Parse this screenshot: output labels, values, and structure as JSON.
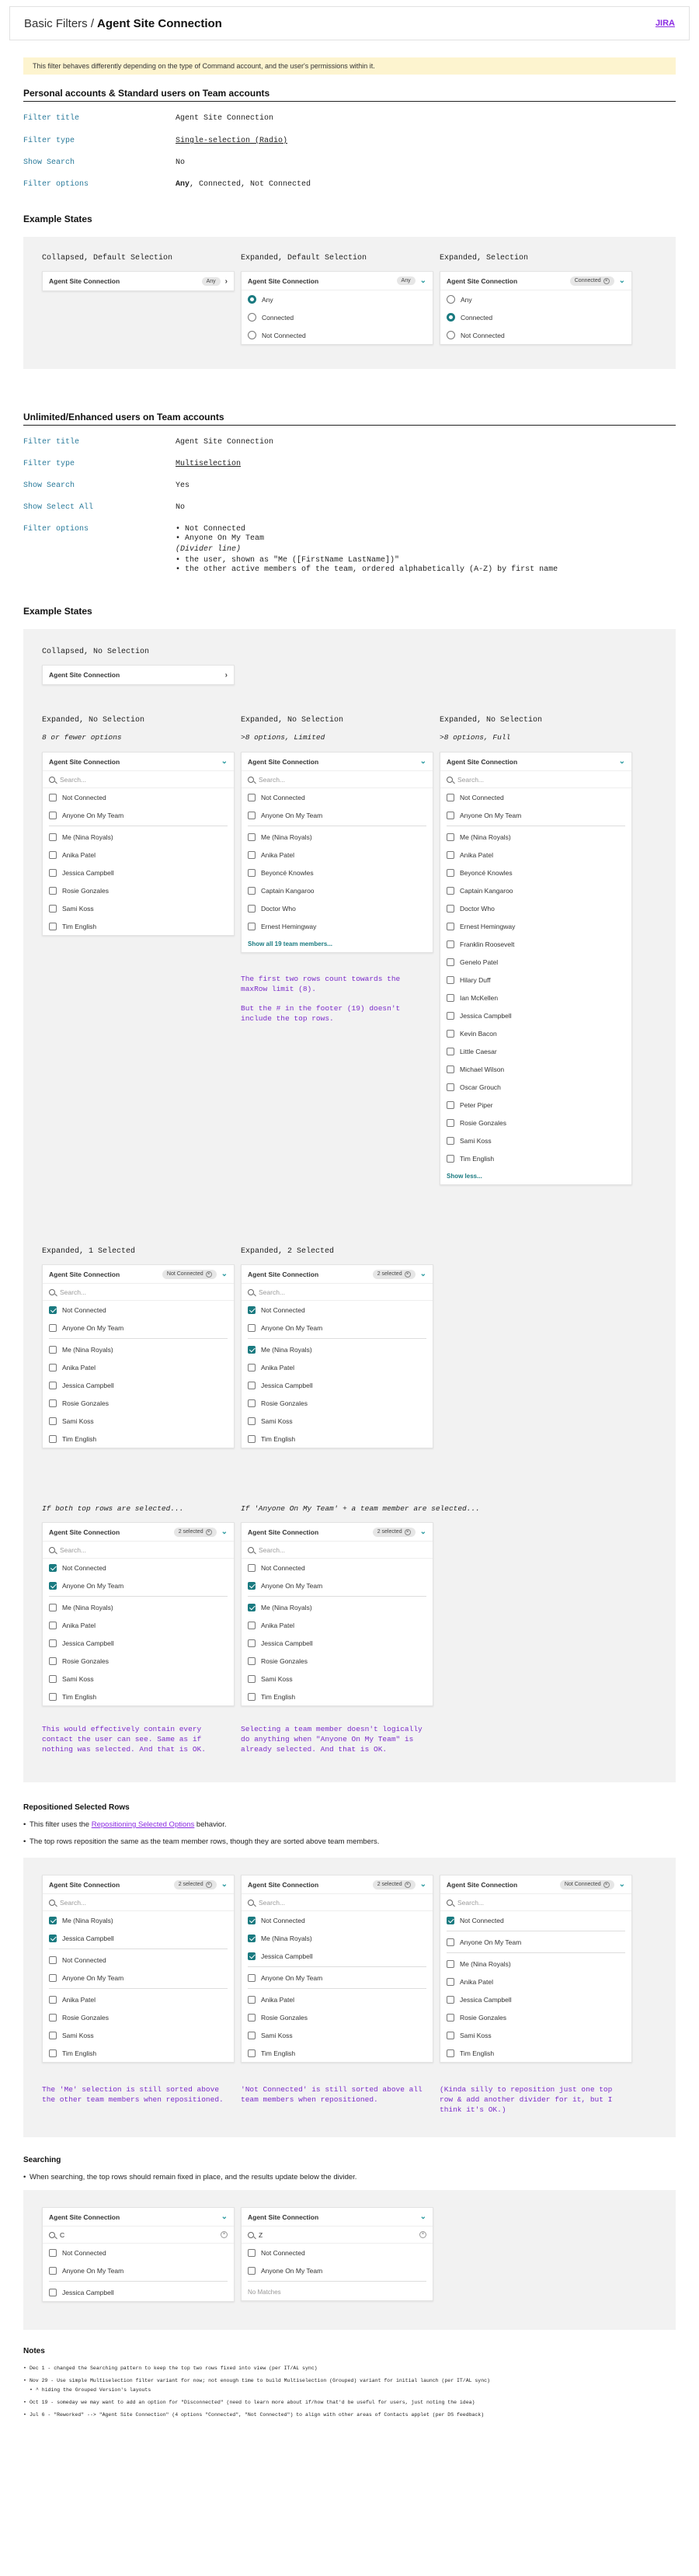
{
  "header": {
    "crumb": "Basic Filters /",
    "title": "Agent Site Connection",
    "jira": "JIRA"
  },
  "notice": "This filter behaves differently depending on the type of Command account, and the user's permissions within it.",
  "section1": {
    "title": "Personal accounts & Standard users on Team accounts",
    "props": [
      {
        "k": "Filter title",
        "v": "Agent Site Connection"
      },
      {
        "k": "Filter type",
        "v": "Single-selection (Radio)"
      },
      {
        "k": "Show Search",
        "v": "No"
      },
      {
        "k": "Filter options",
        "v_bold": "Any",
        "v_rest": ", Connected, Not Connected"
      }
    ],
    "example_title": "Example States",
    "states": [
      "Collapsed, Default Selection",
      "Expanded, Default Selection",
      "Expanded, Selection"
    ],
    "card_title": "Agent Site Connection",
    "chip_any": "Any",
    "chip_connected": "Connected",
    "radio_options": [
      "Any",
      "Connected",
      "Not Connected"
    ]
  },
  "section2": {
    "title": "Unlimited/Enhanced users on Team accounts",
    "props": [
      {
        "k": "Filter title",
        "v": "Agent Site Connection"
      },
      {
        "k": "Filter type",
        "v": "Multiselection"
      },
      {
        "k": "Show Search",
        "v": "Yes"
      },
      {
        "k": "Show Select All",
        "v": "No"
      },
      {
        "k": "Filter options",
        "lines": [
          "• Not Connected",
          "• Anyone On My Team",
          "(Divider line)",
          "• the user, shown as \"Me ([FirstName LastName])\"",
          "• the other active members of the team, ordered alphabetically (A-Z) by first name"
        ]
      }
    ],
    "example_title": "Example States",
    "collapsed_label": "Collapsed, No Selection",
    "exp_none": "Expanded, No Selection",
    "sub_few": "8 or fewer options",
    "sub_limited": ">8 options, Limited",
    "sub_full": ">8 options, Full",
    "search_ph": "Search...",
    "show_all": "Show all 19 team members...",
    "show_less": "Show less...",
    "note_limited_1": "The first two rows count towards the maxRow limit (8).",
    "note_limited_2": "But the # in the footer (19) doesn't include the top rows.",
    "exp_one": "Expanded, 1 Selected",
    "exp_two": "Expanded, 2 Selected",
    "chip_not_connected": "Not Connected",
    "chip_2sel": "2 selected",
    "if_both": "If both top rows are selected...",
    "if_anyone": "If 'Anyone On My Team' + a team member are selected...",
    "note_both": "This would effectively contain every contact the user can see. Same as if nothing was selected. And that is OK.",
    "note_anyone": "Selecting a team member doesn't logically do anything when \"Anyone On My Team\" is already selected. And that is OK.",
    "top_rows": [
      "Not Connected",
      "Anyone On My Team"
    ],
    "few_members": [
      "Me (Nina Royals)",
      "Anika Patel",
      "Jessica Campbell",
      "Rosie Gonzales",
      "Sami Koss",
      "Tim English"
    ],
    "limited_members": [
      "Me (Nina Royals)",
      "Anika Patel",
      "Beyoncé Knowles",
      "Captain Kangaroo",
      "Doctor Who",
      "Ernest Hemingway"
    ],
    "full_members": [
      "Me (Nina Royals)",
      "Anika Patel",
      "Beyoncé Knowles",
      "Captain Kangaroo",
      "Doctor Who",
      "Ernest Hemingway",
      "Franklin Roosevelt",
      "Genelo Patel",
      "Hilary Duff",
      "Ian McKellen",
      "Jessica Campbell",
      "Kevin Bacon",
      "Little Caesar",
      "Michael Wilson",
      "Oscar Grouch",
      "Peter Piper",
      "Rosie Gonzales",
      "Sami Koss",
      "Tim English"
    ]
  },
  "section3": {
    "title": "Repositioned Selected Rows",
    "bullet1_pre": "This filter uses the ",
    "bullet1_link": "Repositioning Selected Options",
    "bullet1_post": " behavior.",
    "bullet2": "The top rows reposition the same as the team member rows, though they are sorted above team members.",
    "note1": "The 'Me' selection is still sorted above the other team members when repositioned.",
    "note2": "'Not Connected' is still sorted above all team members when repositioned.",
    "note3": "(Kinda silly to reposition just one top row & add another divider for it, but I think it's OK.)"
  },
  "section4": {
    "title": "Searching",
    "bullet": "When searching, the top rows should remain fixed in place, and the results update below the divider.",
    "q1": "C",
    "q2": "Z",
    "no_matches": "No Matches"
  },
  "notes": {
    "title": "Notes",
    "lines": [
      "Dec 1 - changed the Searching pattern to keep the top two rows fixed into view (per IT/AL sync)",
      "Nov 29 - Use simple Multiselection filter variant for now; not enough time to build Multiselection (Grouped) variant for initial launch (per IT/AL sync)",
      "^ hiding the Grouped Version's layouts",
      "Oct 19 - someday we may want to add an option for \"Disconnected\" (need to learn more about if/how that'd be useful for users, just noting the idea)",
      "Jul 6 - \"Reworked\" --> \"Agent Site Connection\" (4 options \"Connected\", \"Not Connected\") to align with other areas of Contacts applet (per DS feedback)"
    ]
  }
}
